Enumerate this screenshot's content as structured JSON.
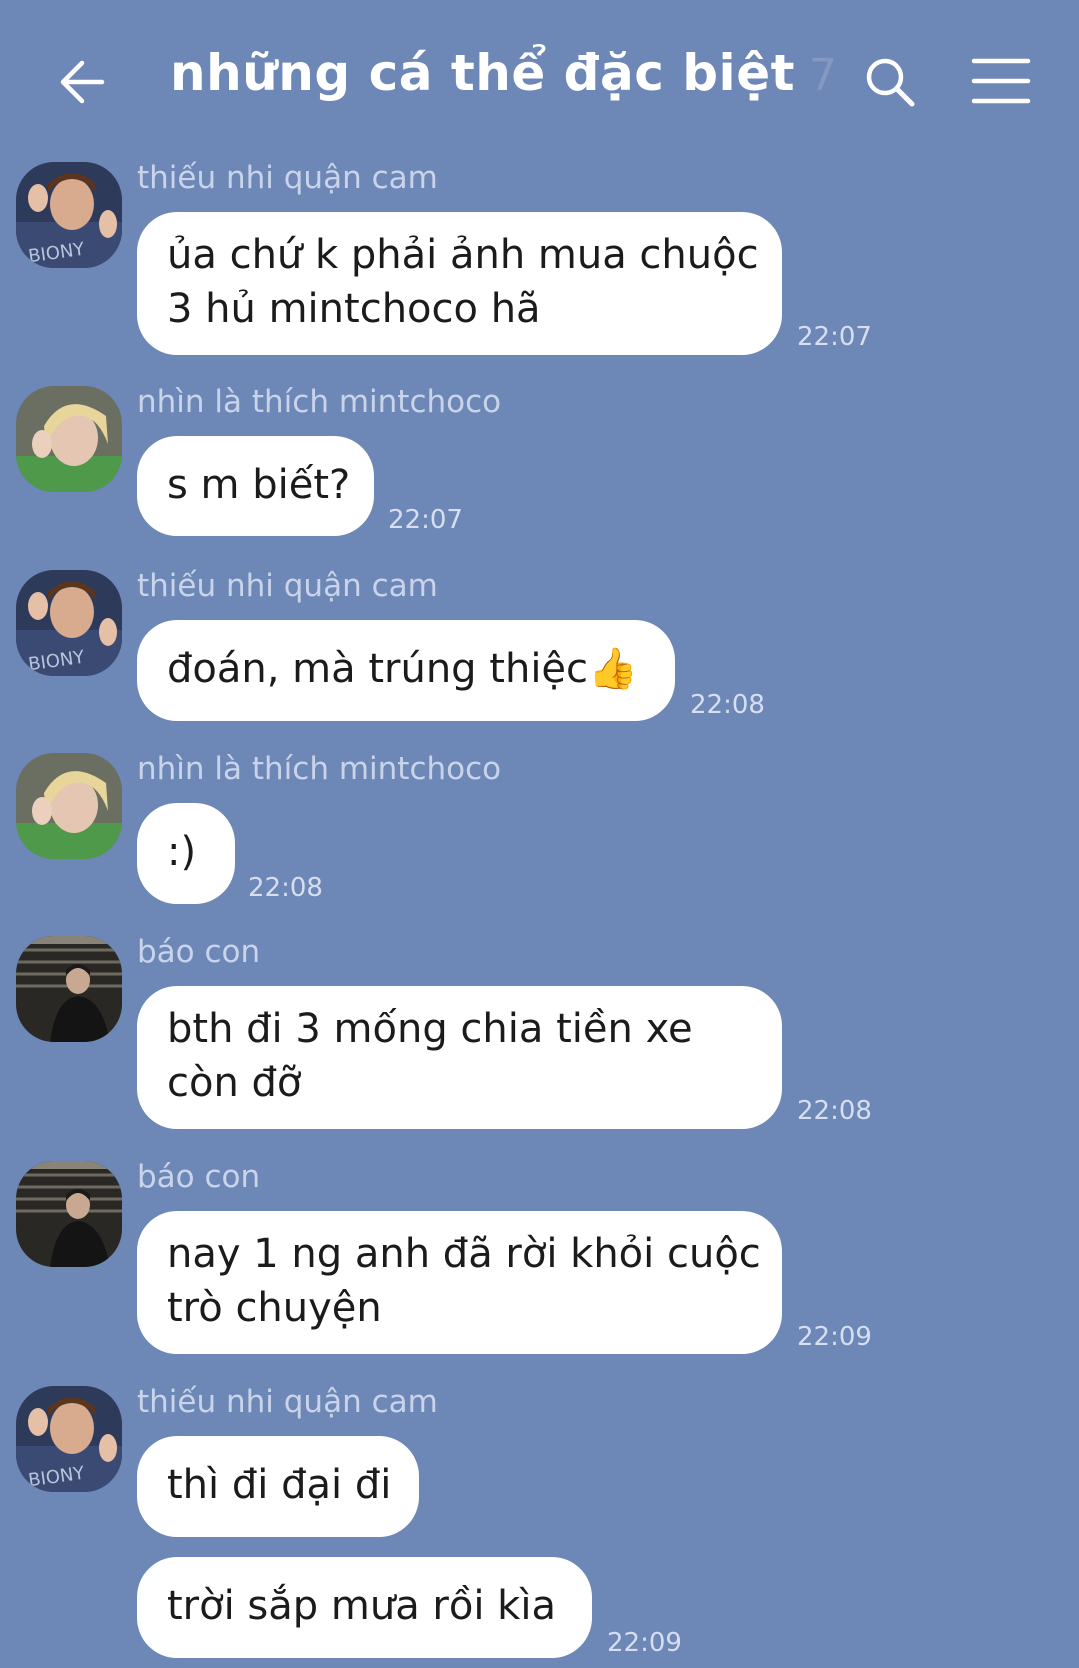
{
  "header": {
    "title": "những cá thể đặc biệt",
    "member_count": "7",
    "icons": {
      "back": "back-arrow-icon",
      "search": "search-icon",
      "menu": "hamburger-menu-icon"
    }
  },
  "messages": [
    {
      "sender": "thiếu nhi quận cam",
      "avatar": "orange",
      "lines": [
        "ủa chứ k phải ảnh mua chuộc",
        "3 hủ mintchoco hã"
      ],
      "time": "22:07"
    },
    {
      "sender": "nhìn là thích mintchoco",
      "avatar": "blonde",
      "lines": [
        "s m biết?"
      ],
      "time": "22:07"
    },
    {
      "sender": "thiếu nhi quận cam",
      "avatar": "orange",
      "lines": [
        "đoán, mà trúng thiệc👍"
      ],
      "time": "22:08"
    },
    {
      "sender": "nhìn là thích mintchoco",
      "avatar": "blonde",
      "lines": [
        ":)"
      ],
      "time": "22:08"
    },
    {
      "sender": "báo con",
      "avatar": "stairs",
      "lines": [
        "bth đi 3 mống chia tiền xe",
        "còn đỡ"
      ],
      "time": "22:08"
    },
    {
      "sender": "báo con",
      "avatar": "stairs",
      "lines": [
        "nay 1 ng anh đã rời khỏi cuộc",
        "trò chuyện"
      ],
      "time": "22:09"
    },
    {
      "sender": "thiếu nhi quận cam",
      "avatar": "orange",
      "lines": [
        "thì đi đại đi"
      ],
      "time": ""
    },
    {
      "sender": "",
      "avatar": "",
      "lines": [
        "trời sắp mưa rồi kìa"
      ],
      "time": "22:09"
    }
  ],
  "colors": {
    "background": "#6d87b6",
    "bubble": "#ffffff",
    "sender": "#c9d4ea",
    "time": "#d6deef"
  }
}
